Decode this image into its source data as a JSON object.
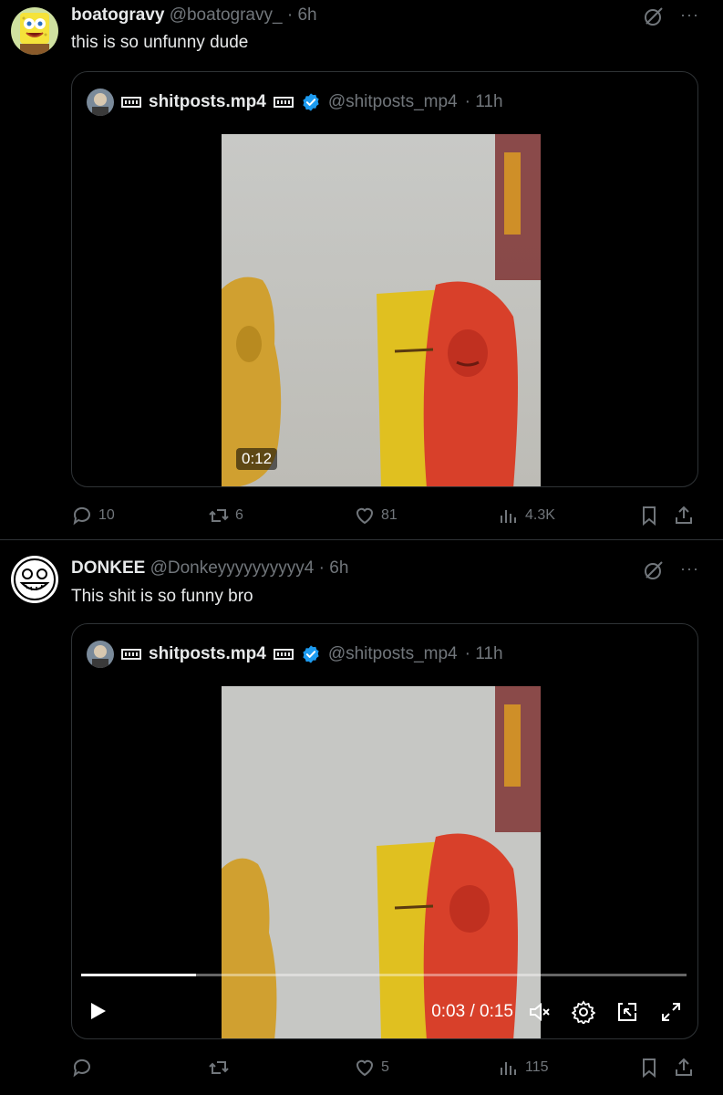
{
  "posts": [
    {
      "author_name": "boatogravy",
      "author_handle": "@boatogravy_",
      "timestamp": "· 6h",
      "text": "this is so unfunny dude",
      "quoted": {
        "name": "shitposts.mp4",
        "handle": "@shitposts_mp4",
        "timestamp": "· 11h",
        "video_duration": "0:12"
      },
      "stats": {
        "replies": "10",
        "reposts": "6",
        "likes": "81",
        "views": "4.3K"
      }
    },
    {
      "author_name": "DONKEE",
      "author_handle": "@Donkeyyyyyyyyyy4",
      "timestamp": "· 6h",
      "text": "This shit is so funny bro",
      "quoted": {
        "name": "shitposts.mp4",
        "handle": "@shitposts_mp4",
        "timestamp": "· 11h",
        "video_time": "0:03 / 0:15",
        "progress": 0.19
      },
      "stats": {
        "replies": "",
        "reposts": "",
        "likes": "5",
        "views": "115"
      }
    }
  ],
  "more_label": "···",
  "colors": {
    "background": "#000000",
    "text": "#e7e9ea",
    "muted": "#71767b",
    "border": "#2f3336",
    "verified": "#1d9bf0"
  },
  "icons": [
    "grok-icon",
    "more-icon",
    "verified-badge-icon",
    "reply-icon",
    "repost-icon",
    "like-icon",
    "views-icon",
    "bookmark-icon",
    "share-icon",
    "play-icon",
    "mute-icon",
    "settings-icon",
    "pip-icon",
    "fullscreen-icon"
  ]
}
